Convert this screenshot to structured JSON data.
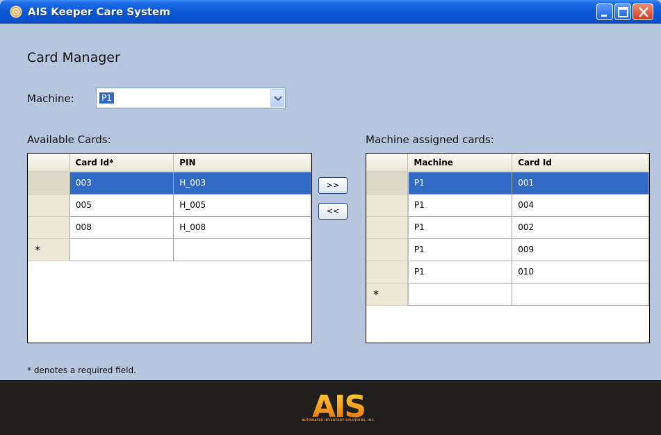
{
  "window": {
    "title": "AIS Keeper Care System",
    "minimize_icon": "minimize-icon",
    "maximize_icon": "maximize-icon",
    "close_icon": "close-icon"
  },
  "page": {
    "title": "Card Manager",
    "machine_label": "Machine:",
    "machine_value": "P1",
    "required_note": "* denotes a required field."
  },
  "available": {
    "label": "Available Cards:",
    "columns": [
      "Card Id*",
      "PIN"
    ],
    "rows": [
      {
        "card_id": "003",
        "pin": "H_003",
        "selected": true
      },
      {
        "card_id": "005",
        "pin": "H_005",
        "selected": false
      },
      {
        "card_id": "008",
        "pin": "H_008",
        "selected": false
      }
    ],
    "new_row_marker": "*"
  },
  "buttons": {
    "assign": ">>",
    "unassign": "<<"
  },
  "assigned": {
    "label": "Machine assigned cards:",
    "columns": [
      "Machine",
      "Card Id"
    ],
    "rows": [
      {
        "machine": "P1",
        "card_id": "001",
        "selected": true
      },
      {
        "machine": "P1",
        "card_id": "004",
        "selected": false
      },
      {
        "machine": "P1",
        "card_id": "002",
        "selected": false
      },
      {
        "machine": "P1",
        "card_id": "009",
        "selected": false
      },
      {
        "machine": "P1",
        "card_id": "010",
        "selected": false
      }
    ],
    "new_row_marker": "*"
  },
  "footer": {
    "logo_text": "AIS",
    "logo_subtext": "AUTOMATED INVENTORY SOLUTIONS, INC."
  },
  "colors": {
    "window_bg": "#b5c6de",
    "titlebar": "#0b57d6",
    "selection": "#316ac5",
    "footer_bg": "#211e1e",
    "logo_orange": "#f0a020"
  }
}
